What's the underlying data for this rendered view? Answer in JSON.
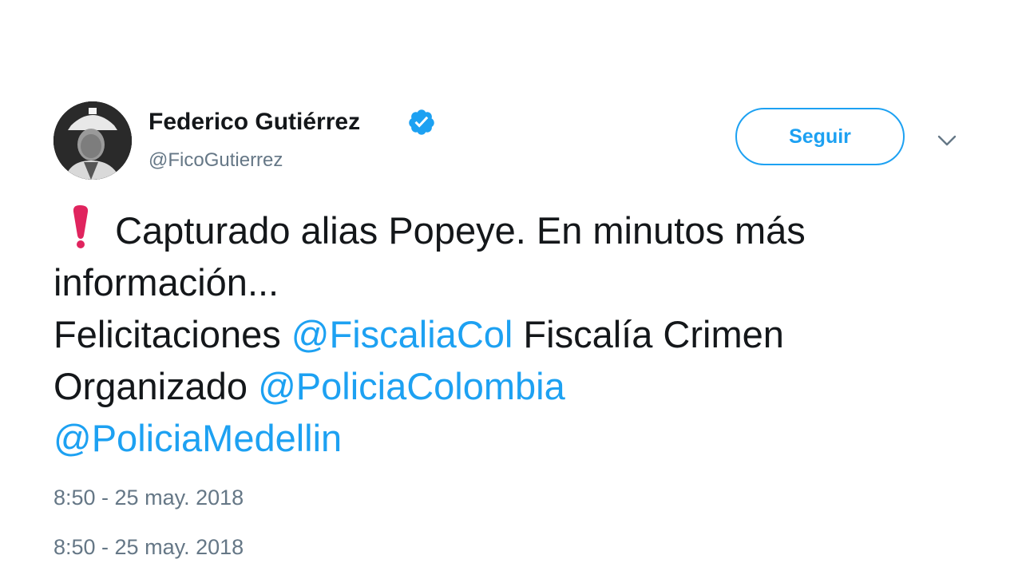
{
  "author": {
    "name": "Federico Gutiérrez",
    "handle": "@FicoGutierrez",
    "verified": true,
    "avatar_icon": "profile-photo-avatar"
  },
  "follow_button": {
    "label": "Seguir"
  },
  "menu": {
    "icon": "chevron-down-icon"
  },
  "tweet": {
    "line1_text": "Capturado alias Popeye. En minutos más",
    "line2_text": "información...",
    "line3_prefix": "Felicitaciones",
    "mention_fiscalia": "@FiscaliaCol",
    "line3_suffix": "Fiscalía Crimen",
    "line4_prefix": "Organizado",
    "mention_policia_colombia": "@PoliciaColombia",
    "mention_policia_medellin": "@PoliciaMedellin",
    "exclaim_icon": "red-exclamation-mark-emoji"
  },
  "timestamps": [
    "8:50 - 25 may. 2018",
    "8:50 - 25 may. 2018"
  ],
  "colors": {
    "accent": "#1da1f2",
    "text": "#14171a",
    "secondary_text": "#657786",
    "verified_badge": "#1da1f2",
    "exclaim": "#e0245e"
  }
}
